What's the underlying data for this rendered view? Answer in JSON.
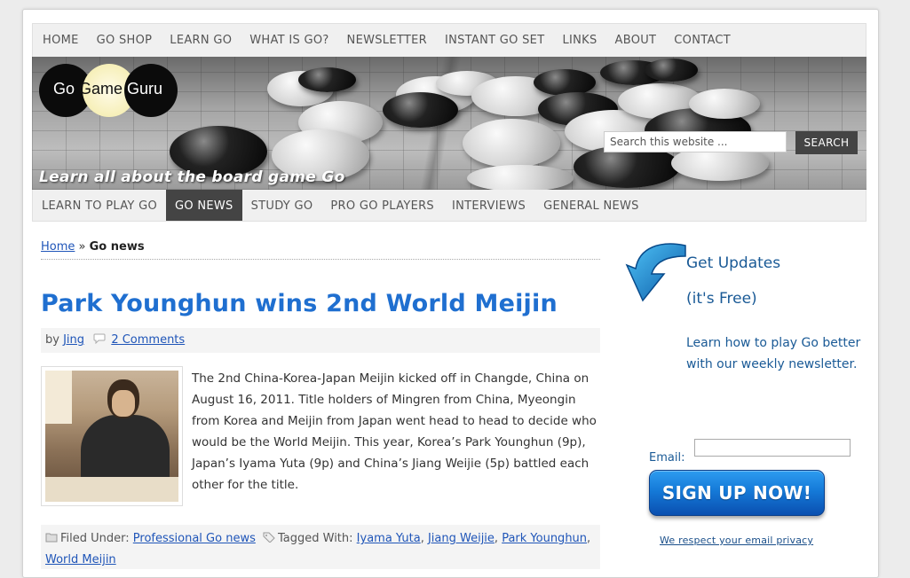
{
  "topnav": {
    "items": [
      "HOME",
      "GO SHOP",
      "LEARN GO",
      "WHAT IS GO?",
      "NEWSLETTER",
      "INSTANT GO SET",
      "LINKS",
      "ABOUT",
      "CONTACT"
    ]
  },
  "header": {
    "logo": {
      "part1": "Go ",
      "part2": "Game",
      "part3": " Guru"
    },
    "tagline": "Learn all about the board game Go",
    "search_placeholder": "Search this website ...",
    "search_button": "SEARCH"
  },
  "subnav": {
    "items": [
      "LEARN TO PLAY GO",
      "GO NEWS",
      "STUDY GO",
      "PRO GO PLAYERS",
      "INTERVIEWS",
      "GENERAL NEWS"
    ],
    "active_index": 1
  },
  "breadcrumb": {
    "home": "Home",
    "separator": "»",
    "current": "Go news"
  },
  "post": {
    "title": "Park Younghun wins 2nd World Meijin",
    "by": "by",
    "author": "Jing",
    "comments": "2 Comments",
    "body": "The 2nd China-Korea-Japan Meijin kicked off in Changde, China on August 16, 2011. Title holders of Mingren from China, Myeongin from Korea and Meijin from Japan went head to head to decide who would be the World Meijin. This year, Korea’s Park Younghun (9p), Japan’s Iyama Yuta (9p) and China’s Jiang Weijie (5p) battled each other for the title.",
    "filed_label": "Filed Under:",
    "category": "Professional Go news",
    "tagged_label": "Tagged With:",
    "tags": [
      "Iyama Yuta",
      "Jiang Weijie",
      "Park Younghun",
      "World Meijin"
    ]
  },
  "sidebar": {
    "heading1": "Get Updates",
    "heading2": "(it's Free)",
    "text": "Learn how to play Go better with our weekly newsletter.",
    "email_label": "Email:",
    "signup": "SIGN UP NOW!",
    "privacy": "We respect your email privacy"
  },
  "colors": {
    "link": "#1f55b8",
    "title": "#1f6fd0",
    "sidebar_text": "#1a5a96",
    "nav_active": "#444444"
  }
}
